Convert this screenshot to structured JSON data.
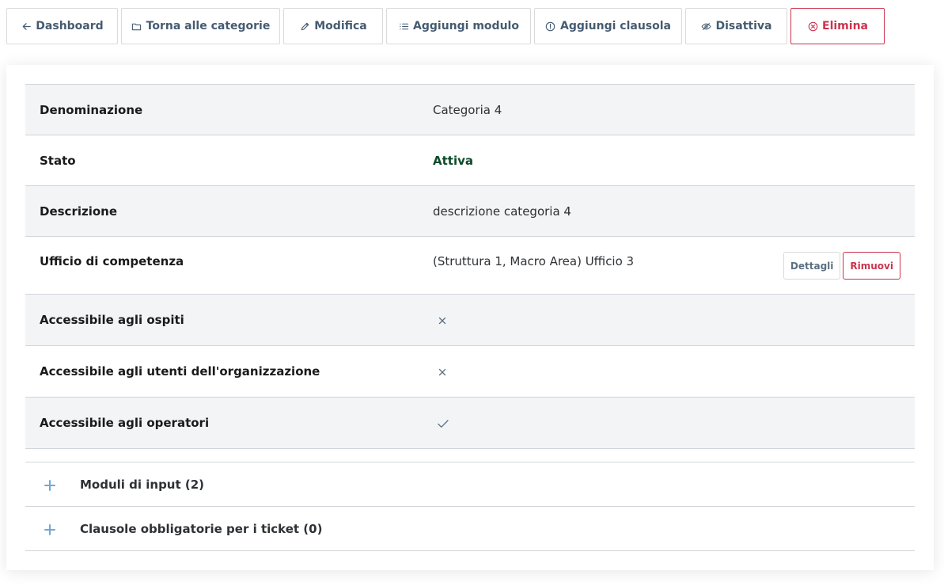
{
  "toolbar": {
    "buttons": [
      {
        "label": "Dashboard",
        "icon": "arrow-left-icon"
      },
      {
        "label": "Torna alle categorie",
        "icon": "folder-icon"
      },
      {
        "label": "Modifica",
        "icon": "pencil-icon"
      },
      {
        "label": "Aggiungi modulo",
        "icon": "list-icon"
      },
      {
        "label": "Aggiungi clausola",
        "icon": "exclamation-circle-icon"
      },
      {
        "label": "Disattiva",
        "icon": "eye-slash-icon"
      },
      {
        "label": "Elimina",
        "icon": "x-circle-icon"
      }
    ]
  },
  "details": {
    "rows": [
      {
        "label": "Denominazione",
        "value": "Categoria 4"
      },
      {
        "label": "Stato",
        "value": "Attiva"
      },
      {
        "label": "Descrizione",
        "value": "descrizione categoria 4"
      },
      {
        "label": "Ufficio di competenza",
        "value": "(Struttura 1, Macro Area) Ufficio 3",
        "actions": {
          "details": "Dettagli",
          "remove": "Rimuovi"
        }
      },
      {
        "label": "Accessibile agli ospiti",
        "value_icon": "cross-icon"
      },
      {
        "label": "Accessibile agli utenti dell'organizzazione",
        "value_icon": "cross-icon"
      },
      {
        "label": "Accessibile agli operatori",
        "value_icon": "check-icon"
      }
    ]
  },
  "accordion": {
    "items": [
      {
        "title": "Moduli di input (2)",
        "icon": "plus-icon"
      },
      {
        "title": "Clausole obbligatorie per i ticket (0)",
        "icon": "plus-icon"
      }
    ]
  },
  "colors": {
    "danger": "#cc334d",
    "active_status": "#0d4a2b",
    "accordion_plus": "#6fa8dc",
    "stripe": "#f2f4f6"
  }
}
